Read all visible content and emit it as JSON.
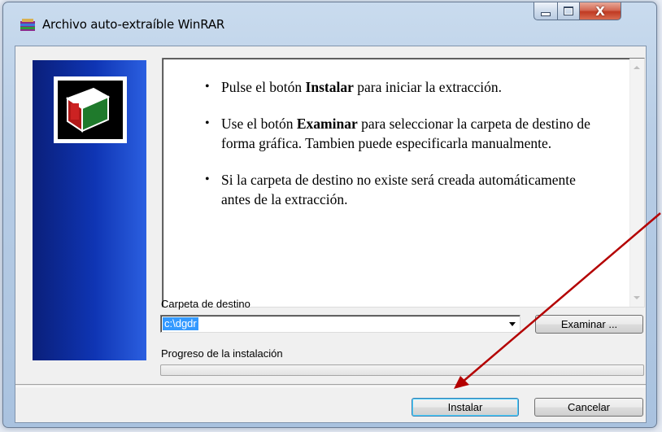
{
  "window": {
    "title": "Archivo auto-extraíble WinRAR",
    "close_glyph": "X"
  },
  "instructions": {
    "bullet1": {
      "pre": "Pulse el botón ",
      "bold": "Instalar",
      "post": " para iniciar la extracción."
    },
    "bullet2": {
      "pre": "Use el botón ",
      "bold": "Examinar",
      "post": " para seleccionar la carpeta de destino de forma gráfica. Tambien puede especificarla manualmente."
    },
    "bullet3": {
      "text": "Si la carpeta de destino no existe será creada automáticamente antes de la extracción."
    }
  },
  "destination": {
    "label": "Carpeta de destino",
    "value": "c:\\dgdr"
  },
  "buttons": {
    "browse": "Examinar ...",
    "install": "Instalar",
    "cancel": "Cancelar"
  },
  "progress": {
    "label": "Progreso de la instalación",
    "value": 0
  },
  "icons": {
    "app": "winrar-icon",
    "logo": "winrar-box-logo"
  },
  "colors": {
    "banner": "#0f35b4",
    "annotation_arrow": "#b40000",
    "selection": "#3399ff"
  }
}
